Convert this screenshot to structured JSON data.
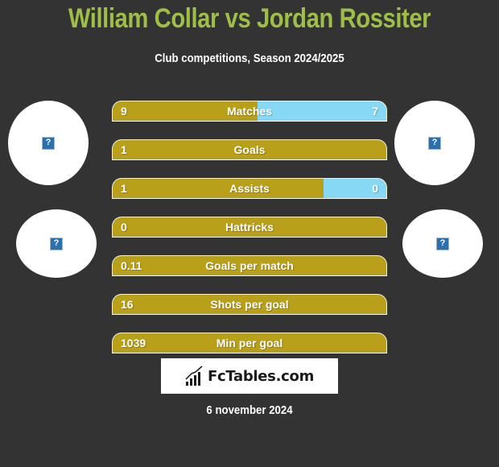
{
  "header": {
    "title": "William Collar vs Jordan Rossiter",
    "subtitle": "Club competitions, Season 2024/2025"
  },
  "players": {
    "left": {
      "name": "William Collar",
      "avatar_icon": "missing-image-icon",
      "club_icon": "missing-image-icon"
    },
    "right": {
      "name": "Jordan Rossiter",
      "avatar_icon": "missing-image-icon",
      "club_icon": "missing-image-icon"
    }
  },
  "icon_glyph": "?",
  "colors": {
    "title": "#9fbe46",
    "left_bar": "#b9a01b",
    "right_bar": "#87d8f4",
    "background": "#333333"
  },
  "stats": [
    {
      "label": "Matches",
      "left": "9",
      "right": "7",
      "left_share": 0.53
    },
    {
      "label": "Goals",
      "left": "1",
      "right": "",
      "left_share": 1.0
    },
    {
      "label": "Assists",
      "left": "1",
      "right": "0",
      "left_share": 0.77
    },
    {
      "label": "Hattricks",
      "left": "0",
      "right": "",
      "left_share": 1.0
    },
    {
      "label": "Goals per match",
      "left": "0.11",
      "right": "",
      "left_share": 1.0
    },
    {
      "label": "Shots per goal",
      "left": "16",
      "right": "",
      "left_share": 1.0
    },
    {
      "label": "Min per goal",
      "left": "1039",
      "right": "",
      "left_share": 1.0
    }
  ],
  "footer": {
    "logo_text": "FcTables.com",
    "date": "6 november 2024"
  }
}
